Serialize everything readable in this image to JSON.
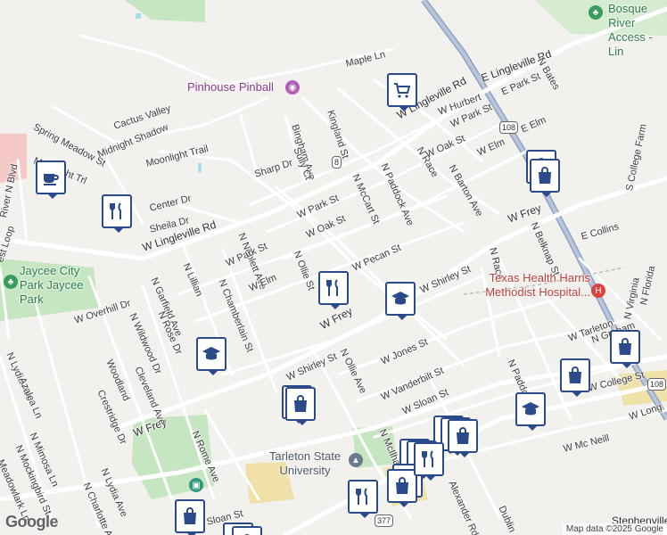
{
  "map": {
    "attribution": "Map data ©2025 Google",
    "logo": "Google",
    "streets": [
      {
        "name": "Maple Ln"
      },
      {
        "name": "E Lingleville Rd"
      },
      {
        "name": "W Lingleville Rd"
      },
      {
        "name": "W Lingleville Rd"
      },
      {
        "name": "N Bates"
      },
      {
        "name": "Kingland St"
      },
      {
        "name": "Bingham Ave"
      },
      {
        "name": "Sully Ct"
      },
      {
        "name": "W Hurbert"
      },
      {
        "name": "E Park St"
      },
      {
        "name": "W Park St"
      },
      {
        "name": "E Elm"
      },
      {
        "name": "N Race"
      },
      {
        "name": "N Paddock Ave"
      },
      {
        "name": "N McCart St"
      },
      {
        "name": "N Barton Ave"
      },
      {
        "name": "W Oak St"
      },
      {
        "name": "W Elm"
      },
      {
        "name": "Spring Meadow St"
      },
      {
        "name": "Cactus Valley"
      },
      {
        "name": "Moonlight Trl"
      },
      {
        "name": "Midnight Shadow"
      },
      {
        "name": "Moonlight Trail"
      },
      {
        "name": "Sharp Dr"
      },
      {
        "name": "River N Blvd"
      },
      {
        "name": "Center Dr"
      },
      {
        "name": "Sheila Dr"
      },
      {
        "name": "W Park St"
      },
      {
        "name": "W Oak St"
      },
      {
        "name": "W Pecan St"
      },
      {
        "name": "W Frey"
      },
      {
        "name": "E Collins"
      },
      {
        "name": "N Belknap St"
      },
      {
        "name": "N Race"
      },
      {
        "name": "S College Farm"
      },
      {
        "name": "N Neblett Ave"
      },
      {
        "name": "N Ollie St"
      },
      {
        "name": "N Lillian"
      },
      {
        "name": "N Chamberlain St"
      },
      {
        "name": "N Garfield Ave"
      },
      {
        "name": "W Park St"
      },
      {
        "name": "W Elm"
      },
      {
        "name": "W Overhill Dr"
      },
      {
        "name": "N Rose Dr"
      },
      {
        "name": "N Wildwood Dr"
      },
      {
        "name": "W Shirley St"
      },
      {
        "name": "W Shirley St"
      },
      {
        "name": "W Frey"
      },
      {
        "name": "W Frey"
      },
      {
        "name": "N Ollie Ave"
      },
      {
        "name": "W Jones St"
      },
      {
        "name": "N Lydia Ave"
      },
      {
        "name": "Azalea Ln"
      },
      {
        "name": "Woodland"
      },
      {
        "name": "Cleveland Ave"
      },
      {
        "name": "Crestridge Dr"
      },
      {
        "name": "N Rome Ave"
      },
      {
        "name": "W Vanderbilt St"
      },
      {
        "name": "W Sloan St"
      },
      {
        "name": "W Tarleton"
      },
      {
        "name": "N Graham"
      },
      {
        "name": "N Paddock"
      },
      {
        "name": "W College St"
      },
      {
        "name": "W Long"
      },
      {
        "name": "W Mc Neill"
      },
      {
        "name": "N Mimosa Ln"
      },
      {
        "name": "N Mockingbird St"
      },
      {
        "name": "Meadowlark Ln"
      },
      {
        "name": "N Lydia Ave"
      },
      {
        "name": "N Charlotte Ave"
      },
      {
        "name": "N McIlhaney"
      },
      {
        "name": "Alexander Rd"
      },
      {
        "name": "Dublin"
      },
      {
        "name": "N Florida"
      },
      {
        "name": "N Virginia"
      },
      {
        "name": "est Loop"
      },
      {
        "name": "Sloan St"
      },
      {
        "name": "Stephenville"
      }
    ],
    "shields": [
      {
        "label": "8"
      },
      {
        "label": "108"
      },
      {
        "label": "108"
      },
      {
        "label": "377"
      }
    ],
    "pois": [
      {
        "name": "Pinhouse Pinball",
        "icon": "camera-icon"
      },
      {
        "name": "Jaycee City Park Jaycee Park",
        "icon": "park-icon"
      },
      {
        "name": "Bosque River Access - Lin",
        "icon": "park-icon"
      },
      {
        "name": "Texas Health Harris Methodist Hospital...",
        "icon": "hospital-icon"
      },
      {
        "name": "Tarleton State University",
        "icon": "university-icon"
      }
    ],
    "markers": [
      {
        "icon": "cart-icon"
      },
      {
        "icon": "coffee-icon"
      },
      {
        "icon": "restaurant-icon"
      },
      {
        "icon": "shopping-bag-icon"
      },
      {
        "icon": "shopping-bag-icon"
      },
      {
        "icon": "restaurant-icon"
      },
      {
        "icon": "school-icon"
      },
      {
        "icon": "school-icon"
      },
      {
        "icon": "shopping-bag-icon"
      },
      {
        "icon": "shopping-bag-icon"
      },
      {
        "icon": "shopping-bag-icon"
      },
      {
        "icon": "shopping-bag-icon"
      },
      {
        "icon": "school-icon"
      },
      {
        "icon": "shopping-bag-icon"
      },
      {
        "icon": "shopping-bag-icon"
      },
      {
        "icon": "shopping-bag-icon"
      },
      {
        "icon": "restaurant-icon"
      },
      {
        "icon": "restaurant-icon"
      },
      {
        "icon": "shopping-bag-icon"
      },
      {
        "icon": "restaurant-icon"
      },
      {
        "icon": "shopping-bag-icon"
      },
      {
        "icon": "restaurant-icon"
      },
      {
        "icon": "shopping-bag-icon"
      },
      {
        "icon": "shopping-bag-icon"
      },
      {
        "icon": "shopping-bag-icon"
      }
    ],
    "colors": {
      "marker_border": "#2b4a8a",
      "park": "#c6e5c1",
      "water": "#a8dcf0",
      "highway": "#8ea3c2"
    }
  }
}
